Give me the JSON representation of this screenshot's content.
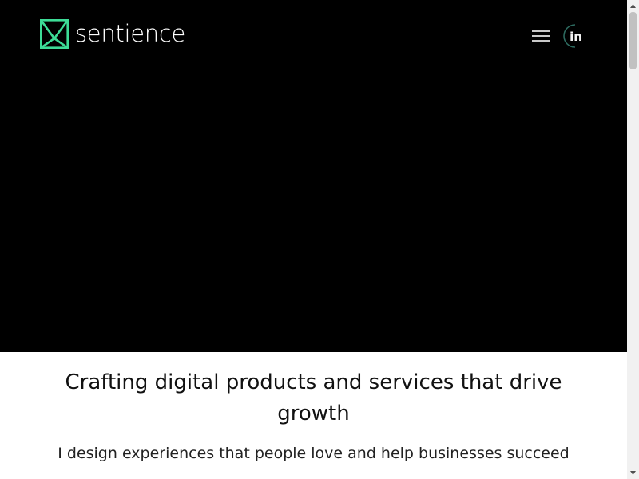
{
  "header": {
    "logo_text": "sentience",
    "menu_icon": "hamburger-icon",
    "linkedin_label": "in"
  },
  "intro": {
    "headline": "Crafting digital products and services that drive growth",
    "tagline": "I design experiences that people love and help businesses succeed"
  },
  "colors": {
    "brand_accent": "#3ddc97",
    "hero_background": "#000000",
    "page_background": "#ffffff"
  }
}
